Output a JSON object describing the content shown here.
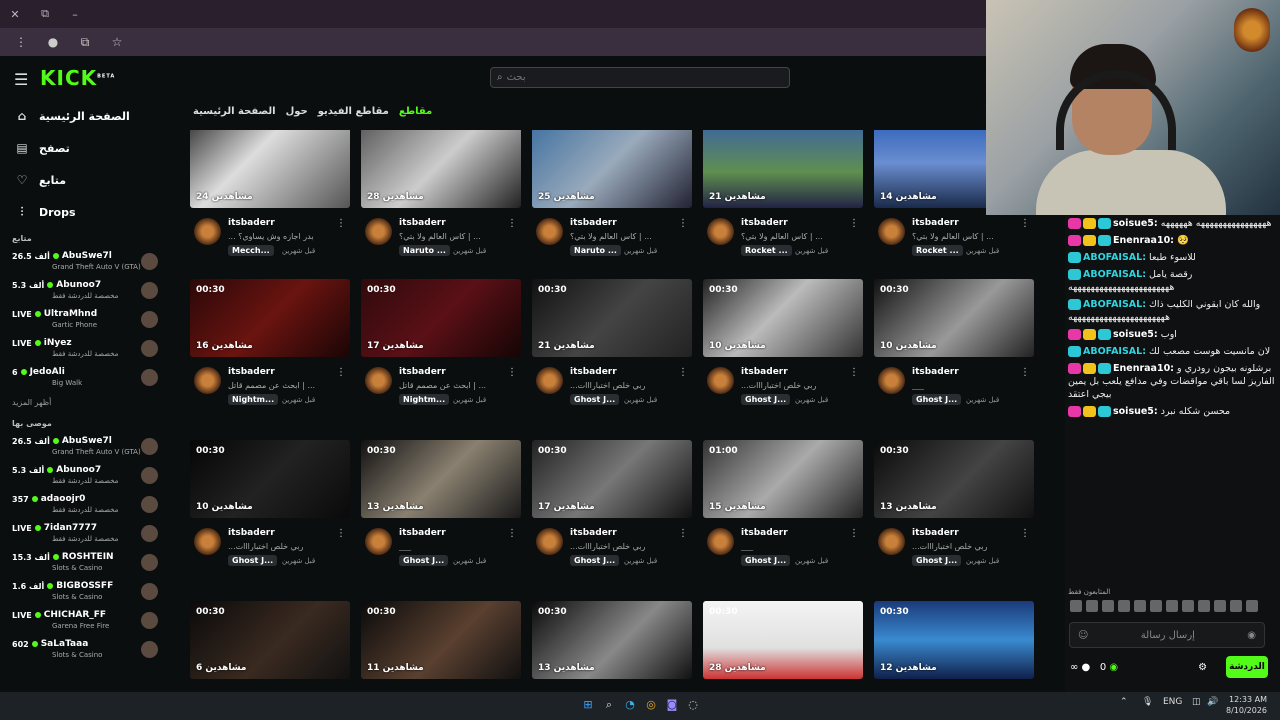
{
  "window": {
    "buttons": [
      "✕",
      "⧉",
      "–"
    ]
  },
  "toolbar": {
    "icons": [
      "⋮",
      "●",
      "⧉",
      "☆"
    ]
  },
  "brand": {
    "logo": "KICK",
    "beta": "BETA",
    "accent": "#53fc18"
  },
  "search": {
    "placeholder": "بحث"
  },
  "nav": [
    {
      "label": "الصفحة الرئيسية",
      "icon": "home-icon",
      "glyph": "⌂"
    },
    {
      "label": "تصفح",
      "icon": "browse-icon",
      "glyph": "▤"
    },
    {
      "label": "متابع",
      "icon": "heart-icon",
      "glyph": "♡"
    },
    {
      "label": "Drops",
      "icon": "drops-icon",
      "glyph": "⫶"
    }
  ],
  "following": {
    "title": "متابع",
    "more": "أظهر المزيد",
    "items": [
      {
        "viewers": "26.5 ألف",
        "live": true,
        "name": "AbuSwe7l",
        "game": "Grand Theft Auto V (GTA)"
      },
      {
        "viewers": "5.3 ألف",
        "live": true,
        "name": "Abunoo7",
        "game": "مخصصة للدردشة فقط"
      },
      {
        "viewers": "LIVE",
        "live": true,
        "name": "UltraMhnd",
        "game": "Gartic Phone"
      },
      {
        "viewers": "LIVE",
        "live": true,
        "name": "iNyez",
        "game": "مخصصة للدردشة فقط"
      },
      {
        "viewers": "6",
        "live": true,
        "name": "JedoAli",
        "game": "Big Walk"
      }
    ]
  },
  "recommended": {
    "title": "موصى بها",
    "items": [
      {
        "viewers": "26.5 ألف",
        "name": "AbuSwe7l",
        "game": "Grand Theft Auto V (GTA)"
      },
      {
        "viewers": "5.3 ألف",
        "name": "Abunoo7",
        "game": "مخصصة للدردشة فقط"
      },
      {
        "viewers": "357",
        "name": "adaoojr0",
        "game": "مخصصة للدردشة فقط"
      },
      {
        "viewers": "LIVE",
        "name": "7idan7777",
        "game": "مخصصة للدردشة فقط"
      },
      {
        "viewers": "15.3 ألف",
        "name": "ROSHTEIN",
        "game": "Slots & Casino"
      },
      {
        "viewers": "1.6 ألف",
        "name": "BIGBOSSFF",
        "game": "Slots & Casino"
      },
      {
        "viewers": "LIVE",
        "name": "CHICHAR_FF",
        "game": "Garena Free Fire"
      },
      {
        "viewers": "602",
        "name": "SaLaTaaa",
        "game": "Slots & Casino"
      }
    ]
  },
  "tabs": [
    "الصفحة الرئيسية",
    "حول",
    "مقاطع الفيديو",
    "مقاطع"
  ],
  "clips": [
    {
      "dur": "",
      "views": "24 مشاهدين",
      "channel": "itsbaderr",
      "title": "... بدر اجازه وش يساوي؟",
      "tag": "Mecch...",
      "ago": "قبل شهرين",
      "bg": "linear-gradient(135deg,#333,#ddd 40%,#555)"
    },
    {
      "dur": "",
      "views": "28 مشاهدين",
      "channel": "itsbaderr",
      "title": "كاس العالم ولا بتي؟ | ...",
      "tag": "Naruto ...",
      "ago": "قبل شهرين",
      "bg": "linear-gradient(135deg,#555,#ccc 50%,#222)"
    },
    {
      "dur": "",
      "views": "25 مشاهدين",
      "channel": "itsbaderr",
      "title": "كاس العالم ولا بتي؟ | ...",
      "tag": "Naruto ...",
      "ago": "قبل شهرين",
      "bg": "linear-gradient(135deg,#3e6fa0,#9ab,#223)"
    },
    {
      "dur": "",
      "views": "21 مشاهدين",
      "channel": "itsbaderr",
      "title": "كاس العالم ولا بتي؟ | ...",
      "tag": "Rocket ...",
      "ago": "قبل شهرين",
      "bg": "linear-gradient(180deg,#3860a8,#5f8f50 60%,#224)"
    },
    {
      "dur": "",
      "views": "14 مشاهدين",
      "channel": "itsbaderr",
      "title": "كاس العالم ولا بتي؟ | ...",
      "tag": "Rocket ...",
      "ago": "قبل شهرين",
      "bg": "linear-gradient(180deg,#2c5fb8,#6a8ed0 50%,#1a2a4a)"
    },
    {
      "dur": "00:30",
      "views": "16 مشاهدين",
      "channel": "itsbaderr",
      "title": "ابحث عن مصمم قاتل | ...",
      "tag": "Nightm...",
      "ago": "قبل شهرين",
      "bg": "linear-gradient(135deg,#2a0808,#6a1410 50%,#1a0505)"
    },
    {
      "dur": "00:30",
      "views": "17 مشاهدين",
      "channel": "itsbaderr",
      "title": "ابحث عن مصمم قاتل | ...",
      "tag": "Nightm...",
      "ago": "قبل شهرين",
      "bg": "linear-gradient(135deg,#300a0c,#5a1016 50%,#150505)"
    },
    {
      "dur": "00:30",
      "views": "21 مشاهدين",
      "channel": "itsbaderr",
      "title": "...ربي خلص اختبارااات",
      "tag": "Ghost J...",
      "ago": "قبل شهرين",
      "bg": "linear-gradient(135deg,#111,#444 50%,#222)"
    },
    {
      "dur": "00:30",
      "views": "10 مشاهدين",
      "channel": "itsbaderr",
      "title": "...ربي خلص اختبارااات",
      "tag": "Ghost J...",
      "ago": "قبل شهرين",
      "bg": "linear-gradient(135deg,#222,#bbb 45%,#333)"
    },
    {
      "dur": "00:30",
      "views": "10 مشاهدين",
      "channel": "itsbaderr",
      "title": "___",
      "tag": "Ghost J...",
      "ago": "قبل شهرين",
      "bg": "linear-gradient(135deg,#111,#999 55%,#222)"
    },
    {
      "dur": "00:30",
      "views": "10 مشاهدين",
      "channel": "itsbaderr",
      "title": "...ربي خلص اختبارااات",
      "tag": "Ghost J...",
      "ago": "قبل شهرين",
      "bg": "linear-gradient(135deg,#050505,#222 50%,#0a0a0a)"
    },
    {
      "dur": "00:30",
      "views": "13 مشاهدين",
      "channel": "itsbaderr",
      "title": "___",
      "tag": "Ghost J...",
      "ago": "قبل شهرين",
      "bg": "linear-gradient(135deg,#111,#8a8070 50%,#1a1a1a)"
    },
    {
      "dur": "00:30",
      "views": "17 مشاهدين",
      "channel": "itsbaderr",
      "title": "...ربي خلص اختبارااات",
      "tag": "Ghost J...",
      "ago": "قبل شهرين",
      "bg": "linear-gradient(135deg,#222,#777 50%,#111)"
    },
    {
      "dur": "01:00",
      "views": "15 مشاهدين",
      "channel": "itsbaderr",
      "title": "___",
      "tag": "Ghost J...",
      "ago": "قبل شهرين",
      "bg": "linear-gradient(135deg,#333,#aaa 50%,#222)"
    },
    {
      "dur": "00:30",
      "views": "13 مشاهدين",
      "channel": "itsbaderr",
      "title": "...ربي خلص اختبارااات",
      "tag": "Ghost J...",
      "ago": "قبل شهرين",
      "bg": "linear-gradient(135deg,#0a0a0a,#444 55%,#111)"
    },
    {
      "dur": "00:30",
      "views": "6 مشاهدين",
      "channel": "",
      "title": "",
      "tag": "",
      "ago": "",
      "bg": "linear-gradient(135deg,#0a0a0a,#3a2a20 55%,#111)"
    },
    {
      "dur": "00:30",
      "views": "11 مشاهدين",
      "channel": "",
      "title": "",
      "tag": "",
      "ago": "",
      "bg": "linear-gradient(135deg,#0a0a0a,#5a4030 55%,#111)"
    },
    {
      "dur": "00:30",
      "views": "13 مشاهدين",
      "channel": "",
      "title": "",
      "tag": "",
      "ago": "",
      "bg": "linear-gradient(135deg,#0a0a0a,#888 55%,#111)"
    },
    {
      "dur": "00:30",
      "views": "28 مشاهدين",
      "channel": "",
      "title": "",
      "tag": "",
      "ago": "",
      "bg": "linear-gradient(180deg,#f4f4f4,#e0e0e0 60%,#c33)"
    },
    {
      "dur": "00:30",
      "views": "12 مشاهدين",
      "channel": "",
      "title": "",
      "tag": "",
      "ago": "",
      "bg": "linear-gradient(180deg,#1a3a7a,#3a8ad0 50%,#10204a)"
    }
  ],
  "chat": {
    "messages": [
      {
        "badges": [
          "b1",
          "b2",
          "b3"
        ],
        "user": "soisue5:",
        "color": "#ffffff",
        "text": "ههههههههههههههههه ههههههه"
      },
      {
        "badges": [
          "b1",
          "b2",
          "b3"
        ],
        "user": "Enenraa10:",
        "color": "#ffffff",
        "text": "🥺"
      },
      {
        "badges": [
          "b3"
        ],
        "user": "ABOFAISAL:",
        "color": "#2dd6e0",
        "text": "للاسوء طبعا"
      },
      {
        "badges": [
          "b3"
        ],
        "user": "ABOFAISAL:",
        "color": "#2dd6e0",
        "text": "رقصة يامل هههههههههههههههههههههههه"
      },
      {
        "badges": [
          "b3"
        ],
        "user": "ABOFAISAL:",
        "color": "#2dd6e0",
        "text": "والله كان ابقوني الكليب ذاك ههههههههههههههههههههههه"
      },
      {
        "badges": [
          "b1",
          "b2",
          "b3"
        ],
        "user": "soisue5:",
        "color": "#ffffff",
        "text": "اوب"
      },
      {
        "badges": [
          "b3"
        ],
        "user": "ABOFAISAL:",
        "color": "#2dd6e0",
        "text": "لان مانسيت هوست مصعب لك"
      },
      {
        "badges": [
          "b1",
          "b2",
          "b3"
        ],
        "user": "Enenraa10:",
        "color": "#ffffff",
        "text": "برشلونه بيجون رودري و الفاريز لسا باقي مواقضات وفي مدافع يلعب بل يمين بيجي اعتقد"
      },
      {
        "badges": [
          "b1",
          "b2",
          "b3"
        ],
        "user": "soisue5:",
        "color": "#ffffff",
        "text": "محسن شكله نبرد"
      }
    ],
    "pinned": "المتابعون فقط",
    "input_placeholder": "إرسال رسالة",
    "count": "0",
    "send": "الدردشة"
  },
  "taskbar": {
    "lang": "ENG",
    "time": "12:33 AM",
    "date": "8/10/2026"
  }
}
